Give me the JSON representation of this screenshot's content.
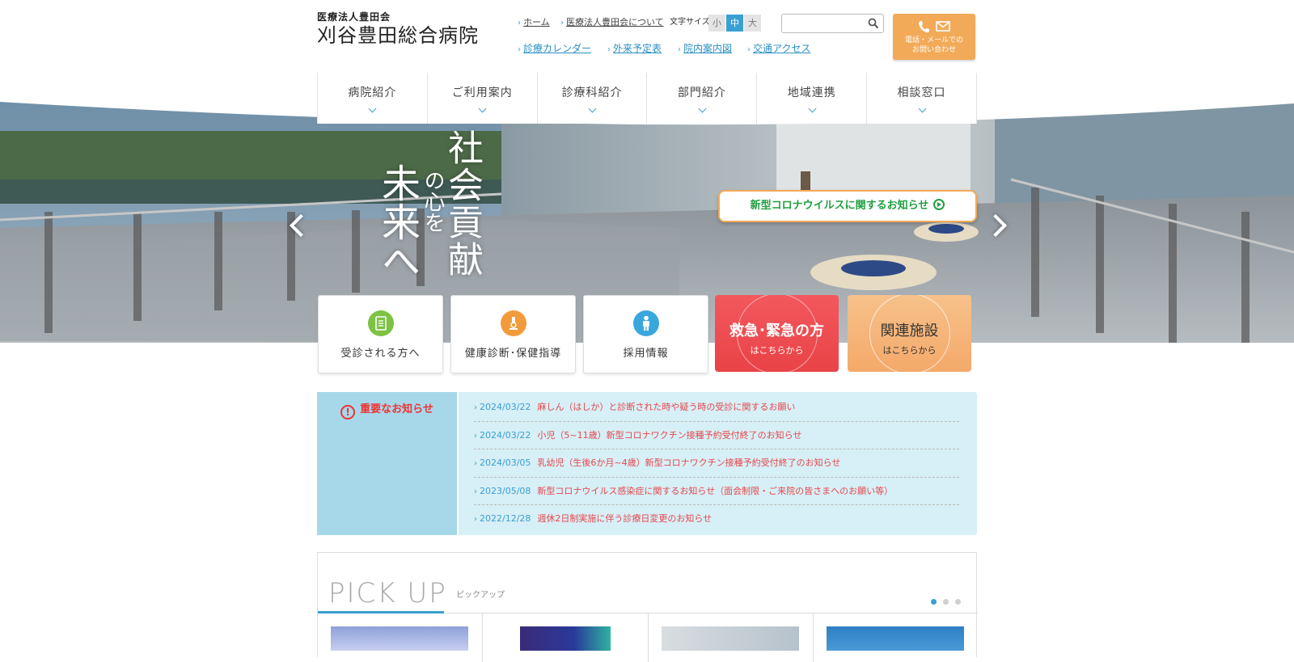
{
  "header": {
    "logo": {
      "org": "医療法人豊田会",
      "name": "刈谷豊田総合病院"
    },
    "util_links": {
      "home": "ホーム",
      "about": "医療法人豊田会について"
    },
    "font_size": {
      "label": "文字サイズ",
      "small": "小",
      "medium": "中",
      "large": "大",
      "selected": "中"
    },
    "search": {
      "placeholder": ""
    },
    "contact": {
      "line1": "電話・メールでの",
      "line2": "お問い合わせ"
    },
    "sub_links": {
      "calendar": "診療カレンダー",
      "outpatient": "外来予定表",
      "floor_guide": "院内案内図",
      "access": "交通アクセス"
    }
  },
  "nav": {
    "items": [
      {
        "label": "病院紹介"
      },
      {
        "label": "ご利用案内"
      },
      {
        "label": "診療科紹介"
      },
      {
        "label": "部門紹介"
      },
      {
        "label": "地域連携"
      },
      {
        "label": "相談窓口"
      }
    ]
  },
  "hero": {
    "copy_line1": "社会貢献",
    "copy_line2": "の心を",
    "copy_line3": "未来へ",
    "covid_banner": "新型コロナウイルスに関するお知らせ"
  },
  "tiles": {
    "visit": "受診される方へ",
    "checkup": "健康診断･保健指導",
    "recruit": "採用情報",
    "emergency_title": "救急･緊急の方",
    "emergency_sub": "はこちらから",
    "related_title": "関連施設",
    "related_sub": "はこちらから"
  },
  "notice": {
    "title": "重要なお知らせ",
    "mark": "!",
    "items": [
      {
        "date": "2024/03/22",
        "text": "麻しん（はしか）と診断された時や疑う時の受診に関するお願い"
      },
      {
        "date": "2024/03/22",
        "text": "小児（5~11歳）新型コロナワクチン接種予約受付終了のお知らせ"
      },
      {
        "date": "2024/03/05",
        "text": "乳幼児（生後6か月~4歳）新型コロナワクチン接種予約受付終了のお知らせ"
      },
      {
        "date": "2023/05/08",
        "text": "新型コロナウイルス感染症に関するお知らせ（面会制限・ご来院の皆さまへのお願い等）"
      },
      {
        "date": "2022/12/28",
        "text": "週休2日制実施に伴う診療日変更のお知らせ"
      }
    ]
  },
  "pickup": {
    "title": "PICK UP",
    "subtitle": "ピックアップ",
    "slide_count": 3,
    "active_slide": 1
  },
  "colors": {
    "accent_blue": "#3a9fd2",
    "contact_orange": "#f3aa58",
    "emergency_red": "#e94347",
    "covid_green": "#20a040",
    "notice_red": "#e5484d"
  },
  "icons": {
    "search": "search-icon",
    "contact_phone": "phone-icon",
    "contact_mail": "mail-icon",
    "tile_visit": "document-icon",
    "tile_checkup": "microscope-icon",
    "tile_recruit": "person-icon",
    "covid_play": "play-circle-icon",
    "notice_mark": "exclamation-icon"
  }
}
